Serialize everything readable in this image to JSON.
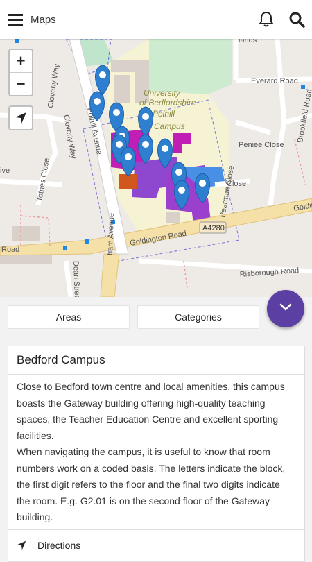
{
  "appbar": {
    "title": "Maps"
  },
  "map": {
    "zoom_in": "+",
    "zoom_out": "−",
    "campus_label": [
      "University",
      "of Bedfordshire",
      "Polhill",
      "Campus"
    ],
    "roads": {
      "goldington": "Goldington Road",
      "goldington_left": "Road",
      "goldington_right": "Golding",
      "a4280": "A4280",
      "polhill": "Polhill Avenue",
      "cloverly": "Cloverly Way",
      "totnes": "Totnes Close",
      "dean": "Dean Street",
      "ham": "ham Avenue",
      "pearman": "Pearman Close",
      "risborough": "Risborough Road",
      "everard": "Everard Road",
      "brookfield": "Brookfield Road",
      "peniee": "Peniee Close",
      "close": "Close",
      "lands": "lands",
      "ive": "ive"
    }
  },
  "tabs": {
    "areas": "Areas",
    "categories": "Categories"
  },
  "card": {
    "title": "Bedford Campus",
    "paragraph1": "Close to Bedford town centre and local amenities, this campus boasts the Gateway building offering high-quality teaching spaces, the Teacher Education Centre and excellent sporting facilities.",
    "paragraph2": "When navigating the campus, it is useful to know that room numbers work on a coded basis. The letters indicate the block, the first digit refers to the floor and the final two digits indicate the room. E.g. G2.01 is on the second floor of the Gateway building.",
    "directions": "Directions"
  },
  "colors": {
    "accent": "#5b3fa3",
    "marker": "#2f7fd1",
    "building_purple": "#9b3fcf",
    "building_magenta": "#c01eb5"
  }
}
